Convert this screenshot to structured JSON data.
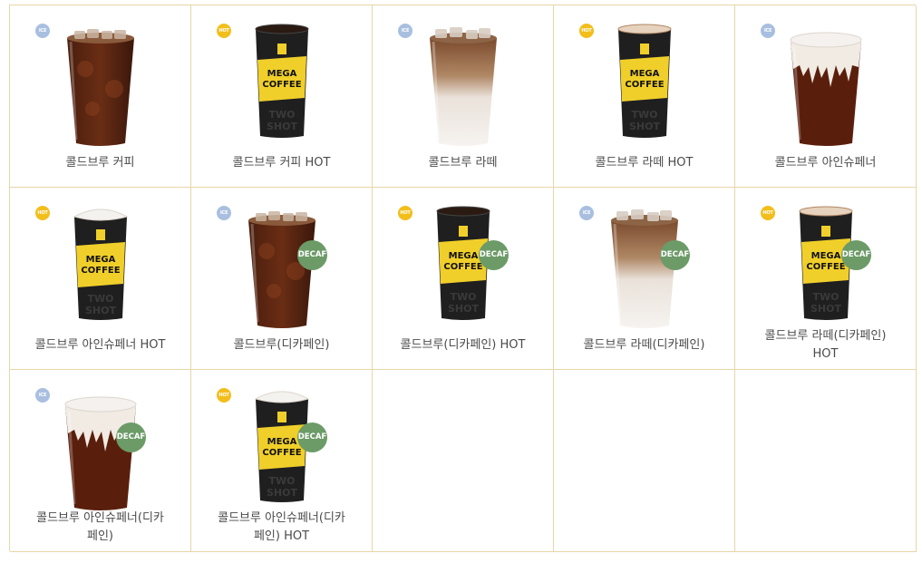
{
  "labels": {
    "ice": "ICE",
    "hot": "HOT",
    "decaf": "DECAF"
  },
  "products": [
    {
      "name": "콜드브루 커피",
      "temp": "ice",
      "cup": "iced-americano",
      "decaf": false
    },
    {
      "name": "콜드브루 커피 HOT",
      "temp": "hot",
      "cup": "hot-black",
      "decaf": false
    },
    {
      "name": "콜드브루 라떼",
      "temp": "ice",
      "cup": "iced-latte",
      "decaf": false
    },
    {
      "name": "콜드브루 라떼 HOT",
      "temp": "hot",
      "cup": "hot-latte",
      "decaf": false
    },
    {
      "name": "콜드브루 아인슈페너",
      "temp": "ice",
      "cup": "iced-einspanner",
      "decaf": false
    },
    {
      "name": "콜드브루 아인슈페너 HOT",
      "temp": "hot",
      "cup": "hot-cream",
      "decaf": false
    },
    {
      "name": "콜드브루(디카페인)",
      "temp": "ice",
      "cup": "iced-americano",
      "decaf": true
    },
    {
      "name": "콜드브루(디카페인) HOT",
      "temp": "hot",
      "cup": "hot-black",
      "decaf": true
    },
    {
      "name": "콜드브루 라떼(디카페인)",
      "temp": "ice",
      "cup": "iced-latte",
      "decaf": true
    },
    {
      "name": "콜드브루 라떼(디카페인)\nHOT",
      "temp": "hot",
      "cup": "hot-latte",
      "decaf": true
    },
    {
      "name": "콜드브루 아인슈페너(디카\n페인)",
      "temp": "ice",
      "cup": "iced-einspanner",
      "decaf": true
    },
    {
      "name": "콜드브루 아인슈페너(디카\n페인) HOT",
      "temp": "hot",
      "cup": "hot-cream",
      "decaf": true
    }
  ],
  "colors": {
    "border": "#e8d6a8",
    "ice": "#a9bfe0",
    "hot": "#f2be1c",
    "decaf": "#6c9b68",
    "sleeve": "#f0cf2a",
    "cup_dark": "#1e1e1e"
  }
}
